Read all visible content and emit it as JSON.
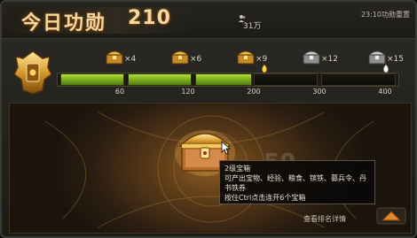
{
  "header": {
    "title": "今日功勋",
    "score": "210",
    "people": "31万",
    "reset_text": "23:10功勋重置"
  },
  "progress": {
    "current": 210,
    "max": 400,
    "milestones": [
      {
        "value": "60",
        "chest_count": "×4",
        "chest_type": "gold",
        "reached": true
      },
      {
        "value": "120",
        "chest_count": "×6",
        "chest_type": "gold",
        "reached": true
      },
      {
        "value": "200",
        "chest_count": "×9",
        "chest_type": "gold",
        "reached": true
      },
      {
        "value": "300",
        "chest_count": "×12",
        "chest_type": "silver",
        "reached": false
      },
      {
        "value": "400",
        "chest_count": "×15",
        "chest_type": "silver",
        "reached": false
      }
    ]
  },
  "main": {
    "ghost_number": "50",
    "tooltip": {
      "title": "2级宝箱",
      "line1": "可产出宝物、经验、粮食、镔铁、募兵令、丹书铁券",
      "line2": "按住Ctrl点击连开6个宝箱"
    }
  },
  "footer": {
    "detail_link": "查看排名详情"
  },
  "colors": {
    "title": "#f3d9a1",
    "progress_fill": "#8cc63f",
    "gold": "#e0b34a",
    "silver": "#b9b9b9"
  },
  "icons": {
    "emblem": "gold-emblem-icon",
    "people": "people-icon",
    "chest_gold": "gold-chest-icon",
    "chest_silver": "silver-chest-icon",
    "big_chest": "big-gold-chest-icon",
    "up_arrow": "up-arrow-icon"
  }
}
